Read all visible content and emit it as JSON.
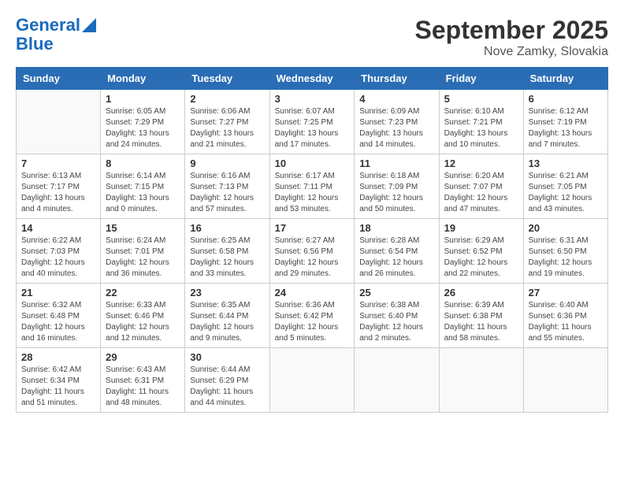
{
  "logo": {
    "line1": "General",
    "line2": "Blue"
  },
  "title": "September 2025",
  "subtitle": "Nove Zamky, Slovakia",
  "days_of_week": [
    "Sunday",
    "Monday",
    "Tuesday",
    "Wednesday",
    "Thursday",
    "Friday",
    "Saturday"
  ],
  "weeks": [
    [
      {
        "day": "",
        "info": ""
      },
      {
        "day": "1",
        "info": "Sunrise: 6:05 AM\nSunset: 7:29 PM\nDaylight: 13 hours\nand 24 minutes."
      },
      {
        "day": "2",
        "info": "Sunrise: 6:06 AM\nSunset: 7:27 PM\nDaylight: 13 hours\nand 21 minutes."
      },
      {
        "day": "3",
        "info": "Sunrise: 6:07 AM\nSunset: 7:25 PM\nDaylight: 13 hours\nand 17 minutes."
      },
      {
        "day": "4",
        "info": "Sunrise: 6:09 AM\nSunset: 7:23 PM\nDaylight: 13 hours\nand 14 minutes."
      },
      {
        "day": "5",
        "info": "Sunrise: 6:10 AM\nSunset: 7:21 PM\nDaylight: 13 hours\nand 10 minutes."
      },
      {
        "day": "6",
        "info": "Sunrise: 6:12 AM\nSunset: 7:19 PM\nDaylight: 13 hours\nand 7 minutes."
      }
    ],
    [
      {
        "day": "7",
        "info": "Sunrise: 6:13 AM\nSunset: 7:17 PM\nDaylight: 13 hours\nand 4 minutes."
      },
      {
        "day": "8",
        "info": "Sunrise: 6:14 AM\nSunset: 7:15 PM\nDaylight: 13 hours\nand 0 minutes."
      },
      {
        "day": "9",
        "info": "Sunrise: 6:16 AM\nSunset: 7:13 PM\nDaylight: 12 hours\nand 57 minutes."
      },
      {
        "day": "10",
        "info": "Sunrise: 6:17 AM\nSunset: 7:11 PM\nDaylight: 12 hours\nand 53 minutes."
      },
      {
        "day": "11",
        "info": "Sunrise: 6:18 AM\nSunset: 7:09 PM\nDaylight: 12 hours\nand 50 minutes."
      },
      {
        "day": "12",
        "info": "Sunrise: 6:20 AM\nSunset: 7:07 PM\nDaylight: 12 hours\nand 47 minutes."
      },
      {
        "day": "13",
        "info": "Sunrise: 6:21 AM\nSunset: 7:05 PM\nDaylight: 12 hours\nand 43 minutes."
      }
    ],
    [
      {
        "day": "14",
        "info": "Sunrise: 6:22 AM\nSunset: 7:03 PM\nDaylight: 12 hours\nand 40 minutes."
      },
      {
        "day": "15",
        "info": "Sunrise: 6:24 AM\nSunset: 7:01 PM\nDaylight: 12 hours\nand 36 minutes."
      },
      {
        "day": "16",
        "info": "Sunrise: 6:25 AM\nSunset: 6:58 PM\nDaylight: 12 hours\nand 33 minutes."
      },
      {
        "day": "17",
        "info": "Sunrise: 6:27 AM\nSunset: 6:56 PM\nDaylight: 12 hours\nand 29 minutes."
      },
      {
        "day": "18",
        "info": "Sunrise: 6:28 AM\nSunset: 6:54 PM\nDaylight: 12 hours\nand 26 minutes."
      },
      {
        "day": "19",
        "info": "Sunrise: 6:29 AM\nSunset: 6:52 PM\nDaylight: 12 hours\nand 22 minutes."
      },
      {
        "day": "20",
        "info": "Sunrise: 6:31 AM\nSunset: 6:50 PM\nDaylight: 12 hours\nand 19 minutes."
      }
    ],
    [
      {
        "day": "21",
        "info": "Sunrise: 6:32 AM\nSunset: 6:48 PM\nDaylight: 12 hours\nand 16 minutes."
      },
      {
        "day": "22",
        "info": "Sunrise: 6:33 AM\nSunset: 6:46 PM\nDaylight: 12 hours\nand 12 minutes."
      },
      {
        "day": "23",
        "info": "Sunrise: 6:35 AM\nSunset: 6:44 PM\nDaylight: 12 hours\nand 9 minutes."
      },
      {
        "day": "24",
        "info": "Sunrise: 6:36 AM\nSunset: 6:42 PM\nDaylight: 12 hours\nand 5 minutes."
      },
      {
        "day": "25",
        "info": "Sunrise: 6:38 AM\nSunset: 6:40 PM\nDaylight: 12 hours\nand 2 minutes."
      },
      {
        "day": "26",
        "info": "Sunrise: 6:39 AM\nSunset: 6:38 PM\nDaylight: 11 hours\nand 58 minutes."
      },
      {
        "day": "27",
        "info": "Sunrise: 6:40 AM\nSunset: 6:36 PM\nDaylight: 11 hours\nand 55 minutes."
      }
    ],
    [
      {
        "day": "28",
        "info": "Sunrise: 6:42 AM\nSunset: 6:34 PM\nDaylight: 11 hours\nand 51 minutes."
      },
      {
        "day": "29",
        "info": "Sunrise: 6:43 AM\nSunset: 6:31 PM\nDaylight: 11 hours\nand 48 minutes."
      },
      {
        "day": "30",
        "info": "Sunrise: 6:44 AM\nSunset: 6:29 PM\nDaylight: 11 hours\nand 44 minutes."
      },
      {
        "day": "",
        "info": ""
      },
      {
        "day": "",
        "info": ""
      },
      {
        "day": "",
        "info": ""
      },
      {
        "day": "",
        "info": ""
      }
    ]
  ]
}
